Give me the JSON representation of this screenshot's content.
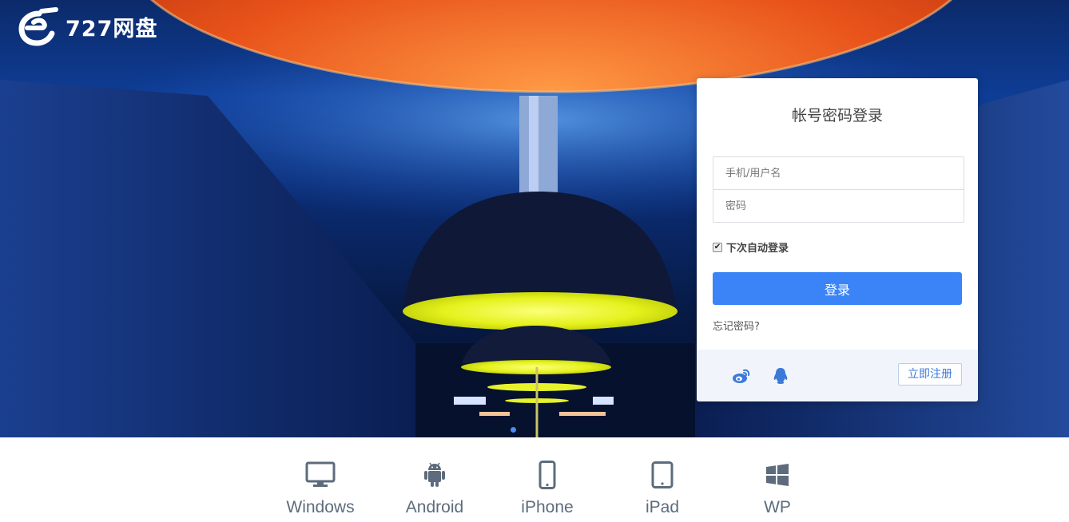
{
  "brand": {
    "name": "727网盘",
    "icon": "eg-logo-icon"
  },
  "login": {
    "title": "帐号密码登录",
    "username_placeholder": "手机/用户名",
    "password_placeholder": "密码",
    "remember_label": "下次自动登录",
    "remember_checked": true,
    "submit_label": "登录",
    "forgot_label": "忘记密码?",
    "register_label": "立即注册",
    "social": [
      {
        "icon": "weibo-icon"
      },
      {
        "icon": "qq-icon"
      }
    ],
    "accent_color": "#3a84f7"
  },
  "platforms": [
    {
      "label": "Windows",
      "icon": "monitor-icon"
    },
    {
      "label": "Android",
      "icon": "android-icon"
    },
    {
      "label": "iPhone",
      "icon": "iphone-icon"
    },
    {
      "label": "iPad",
      "icon": "ipad-icon"
    },
    {
      "label": "WP",
      "icon": "windows-logo-icon"
    }
  ]
}
